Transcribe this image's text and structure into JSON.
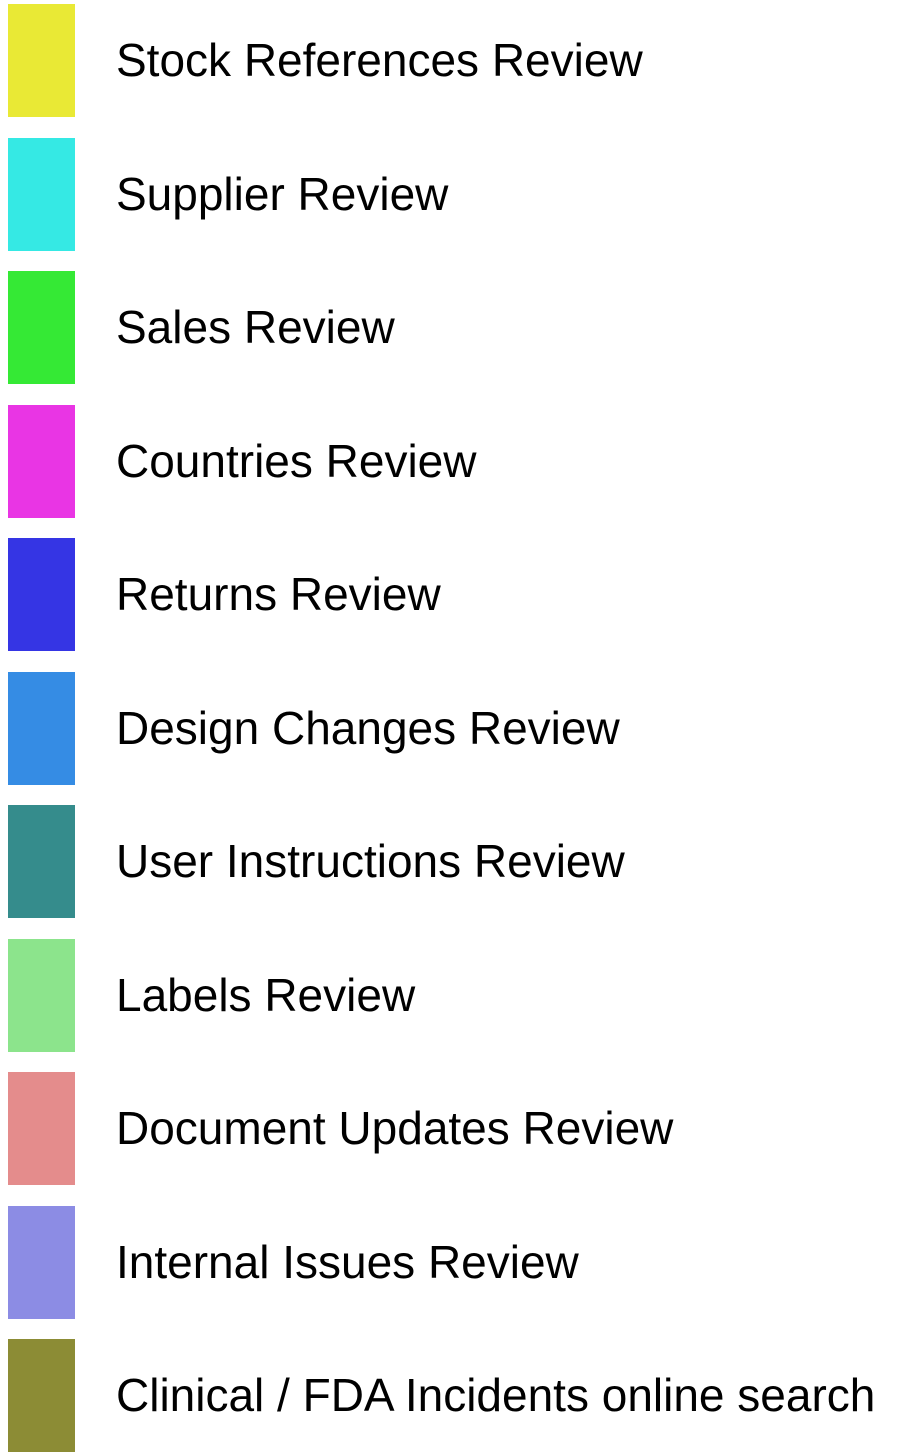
{
  "chart_data": {
    "type": "bar",
    "legend": {
      "placement": "left",
      "entries": [
        {
          "label": "Stock References Review",
          "color": "#E9E935"
        },
        {
          "label": "Supplier Review",
          "color": "#35E9E4"
        },
        {
          "label": "Sales Review",
          "color": "#35E935"
        },
        {
          "label": "Countries Review",
          "color": "#E935E4"
        },
        {
          "label": "Returns Review",
          "color": "#3535E4"
        },
        {
          "label": "Design Changes Review",
          "color": "#358CE4"
        },
        {
          "label": "User Instructions Review",
          "color": "#358C8C"
        },
        {
          "label": "Labels Review",
          "color": "#8CE48C"
        },
        {
          "label": "Document Updates Review",
          "color": "#E48C8C"
        },
        {
          "label": "Internal Issues Review",
          "color": "#8C8CE4"
        },
        {
          "label": "Clinical / FDA Incidents online search",
          "color": "#8C8C35"
        }
      ]
    }
  }
}
